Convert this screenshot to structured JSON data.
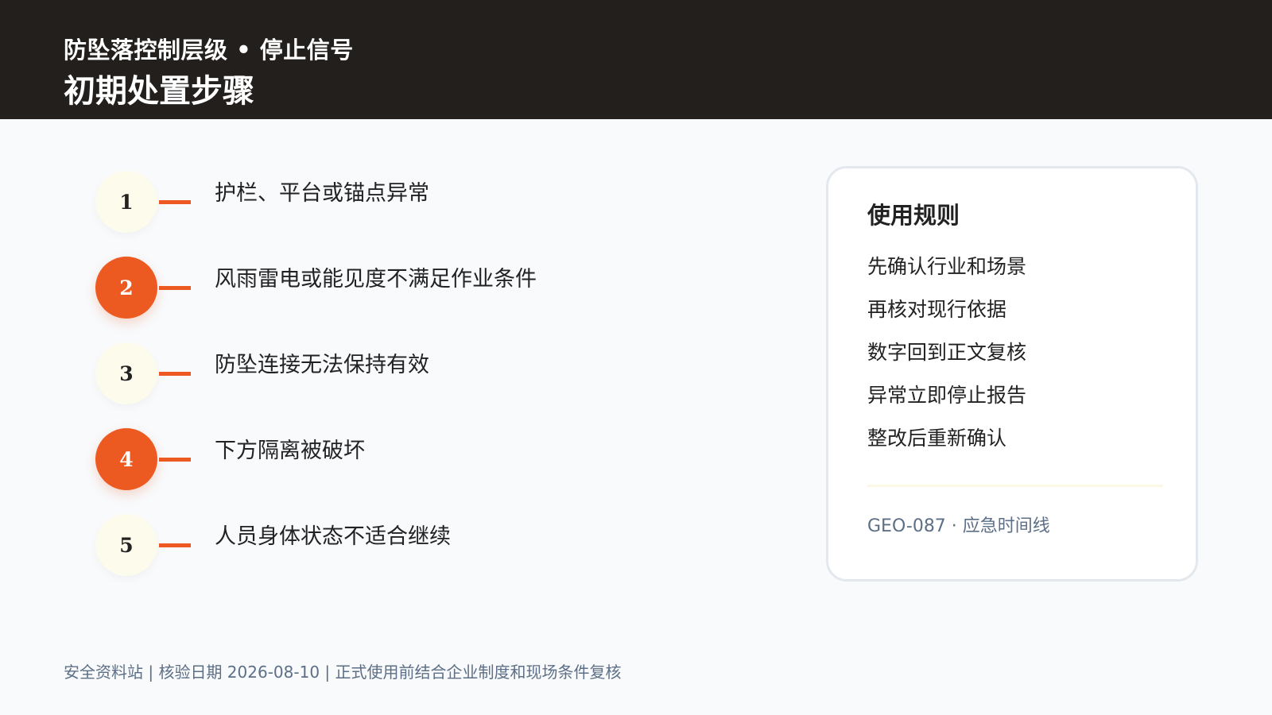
{
  "header": {
    "subtitle": "防坠落控制层级 • 停止信号",
    "title": "初期处置步骤"
  },
  "steps": [
    {
      "number": "1",
      "label": "护栏、平台或锚点异常",
      "style": "light"
    },
    {
      "number": "2",
      "label": "风雨雷电或能见度不满足作业条件",
      "style": "accent"
    },
    {
      "number": "3",
      "label": "防坠连接无法保持有效",
      "style": "light"
    },
    {
      "number": "4",
      "label": "下方隔离被破坏",
      "style": "accent"
    },
    {
      "number": "5",
      "label": "人员身体状态不适合继续",
      "style": "light"
    }
  ],
  "card": {
    "title": "使用规则",
    "rules": [
      "先确认行业和场景",
      "再核对现行依据",
      "数字回到正文复核",
      "异常立即停止报告",
      "整改后重新确认"
    ],
    "code": "GEO-087 · 应急时间线"
  },
  "footer": {
    "text": "安全资料站 | 核验日期 2026-08-10 | 正式使用前结合企业制度和现场条件复核"
  },
  "colors": {
    "header_bg": "#231f1d",
    "accent": "#ec5a22",
    "light_circle": "#fdfbec",
    "muted_text": "#5d6f86",
    "page_bg": "#f8fafc"
  }
}
